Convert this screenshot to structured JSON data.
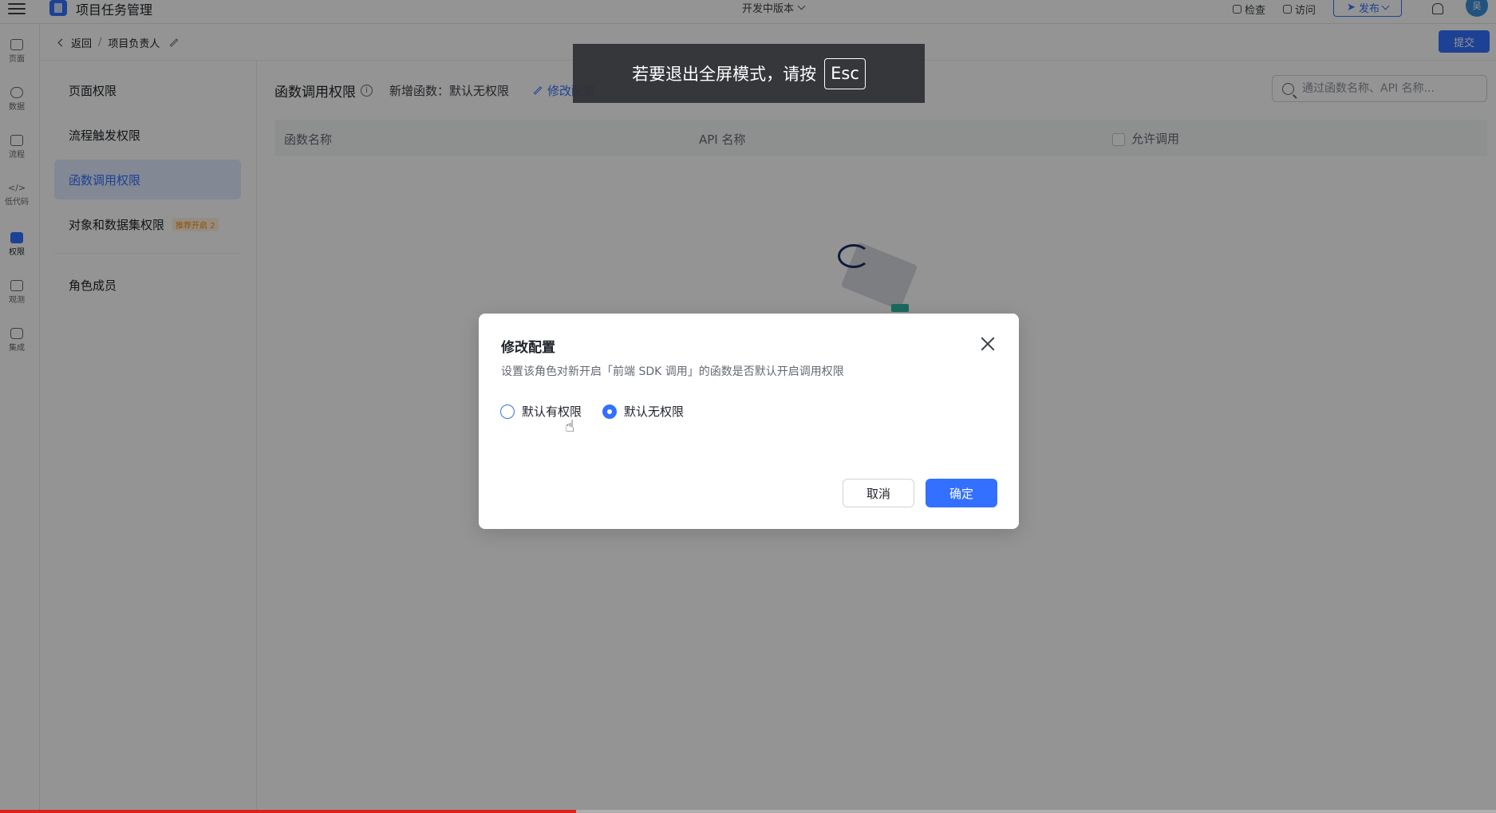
{
  "app": {
    "title": "项目任务管理",
    "version_label": "开发中版本"
  },
  "topbar": {
    "check_label": "检查",
    "visit_label": "访问",
    "publish_label": "发布",
    "avatar_text": "吴"
  },
  "icon_nav": [
    {
      "label": "页面",
      "icon": "page-icon"
    },
    {
      "label": "数据",
      "icon": "database-icon"
    },
    {
      "label": "流程",
      "icon": "flow-icon"
    },
    {
      "label": "低代码",
      "icon": "code-icon"
    },
    {
      "label": "权限",
      "icon": "lock-icon",
      "active": true
    },
    {
      "label": "观测",
      "icon": "observe-icon"
    },
    {
      "label": "集成",
      "icon": "cube-icon"
    }
  ],
  "breadcrumb": {
    "back_label": "返回",
    "separator": "/",
    "current": "项目负责人"
  },
  "submit_label": "提交",
  "sub_menu": {
    "items": [
      "页面权限",
      "流程触发权限",
      "函数调用权限",
      "对象和数据集权限"
    ],
    "badge": "推荐开启 2",
    "role_members": "角色成员",
    "active_index": 2
  },
  "main": {
    "title": "函数调用权限",
    "info_icon_text": "i",
    "note": "新增函数：默认无权限",
    "modify_link": "修改配置",
    "search_placeholder": "通过函数名称、API 名称...",
    "columns": [
      "函数名称",
      "API 名称",
      "允许调用"
    ]
  },
  "fullscreen_toast": {
    "text": "若要退出全屏模式，请按",
    "key": "Esc"
  },
  "modal": {
    "title": "修改配置",
    "description": "设置该角色对新开启「前端 SDK 调用」的函数是否默认开启调用权限",
    "options": [
      "默认有权限",
      "默认无权限"
    ],
    "selected_index": 1,
    "cancel_label": "取消",
    "ok_label": "确定"
  },
  "video_progress": 0.385
}
